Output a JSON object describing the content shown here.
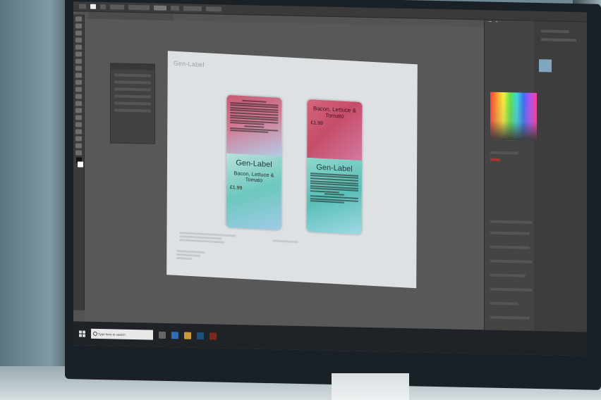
{
  "scene": {
    "description_shown": false
  },
  "app": {
    "document_tab": "",
    "floating_panel_title": ""
  },
  "artboard": {
    "logo": "Gen-Label",
    "labels": [
      {
        "id": "label-left",
        "brand": "Gen-Label",
        "tagline": "",
        "product": "Bacon, Lettuce & Tomato",
        "price": "£1.99",
        "use_by": ""
      },
      {
        "id": "label-right",
        "brand": "Gen-Label",
        "tagline": "",
        "product": "Bacon, Lettuce & Tomato",
        "price": "£1.99",
        "use_by": ""
      }
    ]
  },
  "taskbar": {
    "search_placeholder": "Type here to search",
    "clock": ""
  },
  "colors": {
    "label_top": "#c64d6a",
    "label_bottom": "#59bfb6",
    "ps_bg": "#535353",
    "panel_bg": "#3d3d3d"
  },
  "icons": [
    "search-icon",
    "windows-logo-icon",
    "photoshop-tool-icon"
  ]
}
